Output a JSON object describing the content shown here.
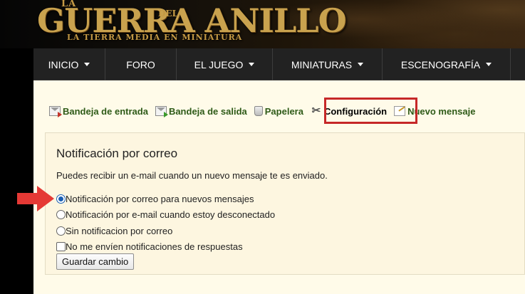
{
  "banner": {
    "logo_la": "LA",
    "logo_main": "GUERRA  ANILLO",
    "logo_del": "DEL",
    "logo_sub": "LA TIERRA MEDIA EN MINIATURA"
  },
  "nav": [
    {
      "label": "INICIO",
      "dropdown": true
    },
    {
      "label": "FORO",
      "dropdown": false
    },
    {
      "label": "EL JUEGO",
      "dropdown": true
    },
    {
      "label": "MINIATURAS",
      "dropdown": true
    },
    {
      "label": "ESCENOGRAFÍA",
      "dropdown": true
    }
  ],
  "tabs": [
    {
      "label": "Bandeja de entrada",
      "icon": "inbox-icon"
    },
    {
      "label": "Bandeja de salida",
      "icon": "outbox-icon"
    },
    {
      "label": "Papelera",
      "icon": "trash-icon"
    },
    {
      "label": "Configuración",
      "icon": "settings-tools-icon",
      "active": true
    },
    {
      "label": "Nuevo mensaje",
      "icon": "new-message-icon"
    }
  ],
  "panel": {
    "title": "Notificación por correo",
    "description": "Puedes recibir un e-mail cuando un nuevo mensaje te es enviado.",
    "options": [
      {
        "label": "Notificación por correo para nuevos mensajes",
        "checked": true
      },
      {
        "label": "Notificación por e-mail cuando estoy desconectado",
        "checked": false
      },
      {
        "label": "Sin notificacion por correo",
        "checked": false
      }
    ],
    "checkbox_label": "No me envíen notificaciones de respuestas",
    "checkbox_checked": false,
    "save_label": "Guardar cambio"
  },
  "colors": {
    "tab_link": "#2e5a17",
    "highlight": "#c62828",
    "pointer_arrow": "#e53935",
    "nav_bg": "#222222",
    "content_bg": "#fffbe9"
  }
}
